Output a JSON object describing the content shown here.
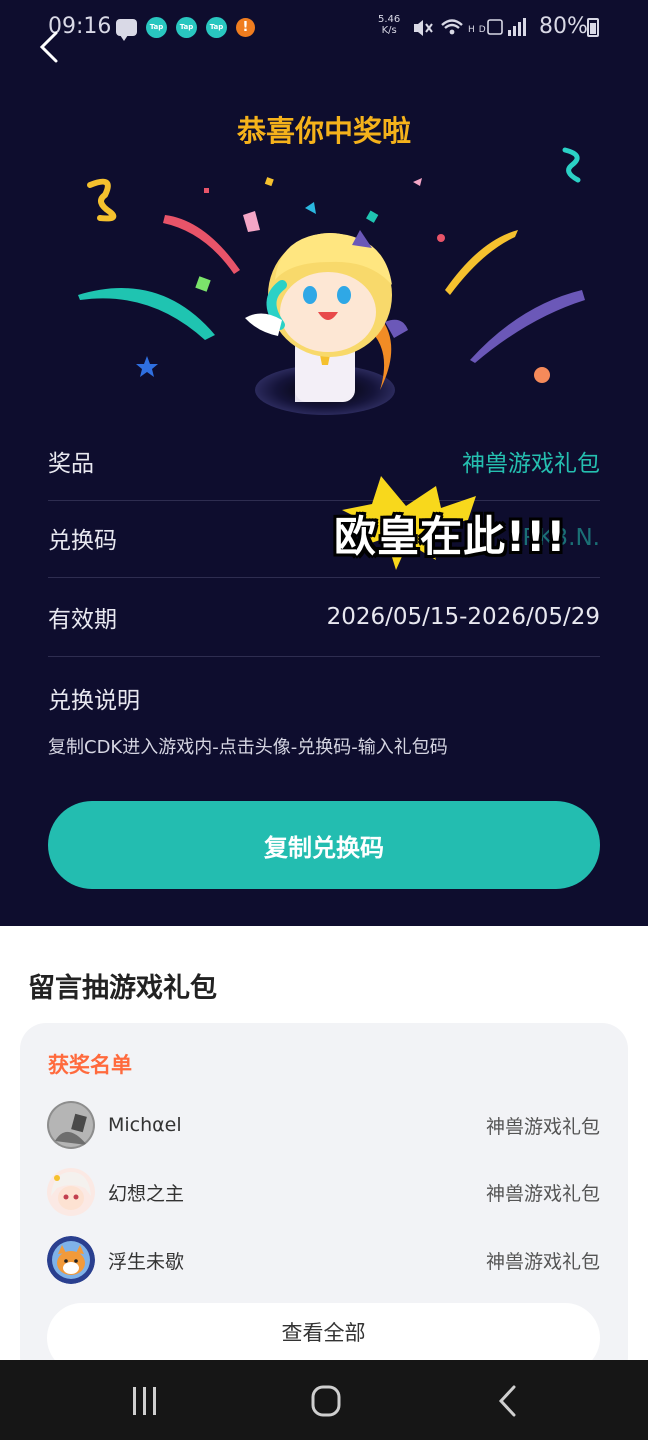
{
  "status_bar": {
    "time": "09:16",
    "net_speed_value": "5.46",
    "net_speed_unit": "K/s",
    "battery": "80%",
    "notification_icons": [
      "message-icon",
      "tap-icon",
      "tap-icon",
      "tap-icon",
      "alert-icon"
    ],
    "tap_label": "Tap",
    "alert_label": "!"
  },
  "header": {
    "title": "恭喜你中奖啦"
  },
  "prize_info": {
    "prize_label": "奖品",
    "prize_value": "神兽游戏礼包",
    "code_label": "兑换码",
    "code_value": "RK3.N.",
    "validity_label": "有效期",
    "validity_value": "2026/05/15-2026/05/29",
    "instructions_label": "兑换说明",
    "instructions_text": "复制CDK进入游戏内-点击头像-兑换码-输入礼包码"
  },
  "overlay": {
    "sticker_text": "欧皇在此!!!"
  },
  "copy_button": {
    "label": "复制兑换码"
  },
  "comments": {
    "title": "留言抽游戏礼包",
    "winners_title": "获奖名单",
    "winners": [
      {
        "name": "Michαel",
        "prize": "神兽游戏礼包"
      },
      {
        "name": "幻想之主",
        "prize": "神兽游戏礼包"
      },
      {
        "name": "浮生未歇",
        "prize": "神兽游戏礼包"
      }
    ],
    "view_all_label": "查看全部"
  },
  "nav_bar": {
    "items": [
      "recent-apps-icon",
      "home-icon",
      "back-icon"
    ]
  },
  "colors": {
    "background": "#0e0d2e",
    "accent_teal": "#23bdb0",
    "title_gold": "#f5b21b",
    "winners_orange": "#ff6a3d"
  }
}
